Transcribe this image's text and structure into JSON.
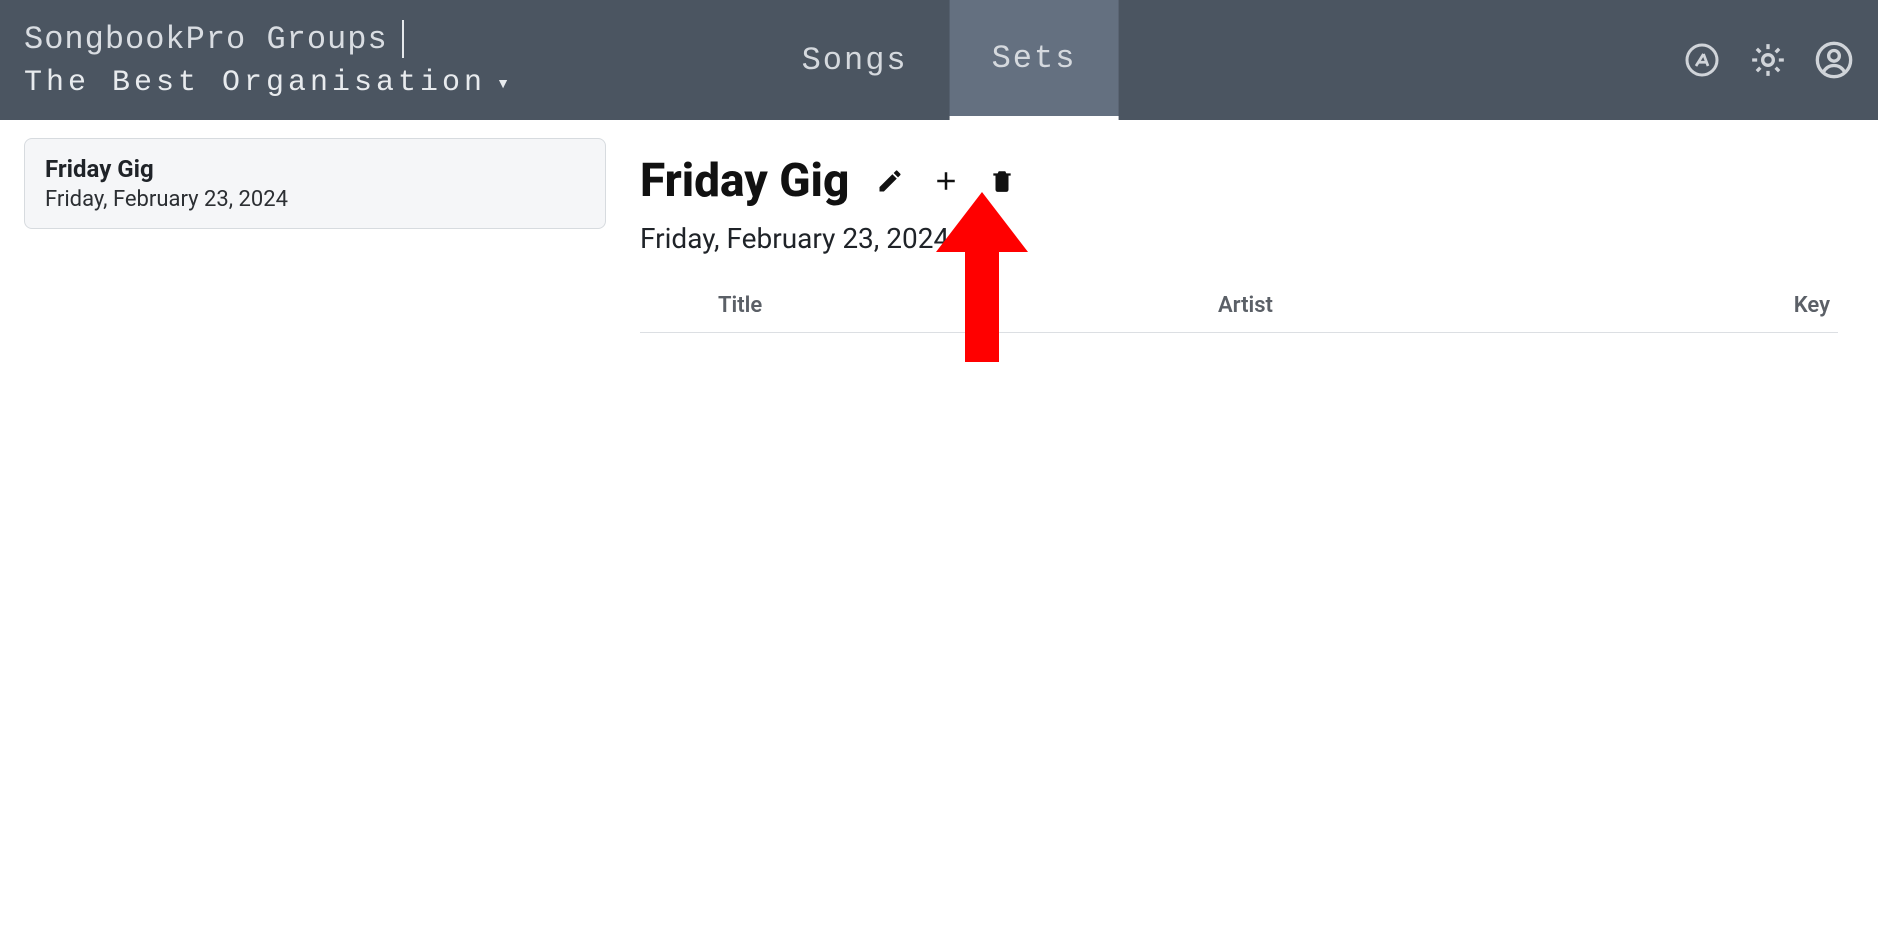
{
  "header": {
    "app_title": "SongbookPro Groups",
    "org_name": "The Best Organisation",
    "tabs": {
      "songs": "Songs",
      "sets": "Sets"
    }
  },
  "sidebar": {
    "sets": [
      {
        "title": "Friday Gig",
        "date": "Friday, February 23, 2024"
      }
    ]
  },
  "main": {
    "set_title": "Friday Gig",
    "set_date": "Friday, February 23, 2024",
    "columns": {
      "title": "Title",
      "artist": "Artist",
      "key": "Key"
    }
  },
  "icons": {
    "autoscroll": "autoscroll-icon",
    "settings": "gear-icon",
    "account": "account-icon",
    "edit": "pencil-icon",
    "add": "plus-icon",
    "delete": "trash-icon",
    "dropdown": "caret-down-icon"
  },
  "colors": {
    "header_bg": "#4b5561",
    "tab_active_bg": "#647080",
    "arrow": "#ff0000"
  }
}
